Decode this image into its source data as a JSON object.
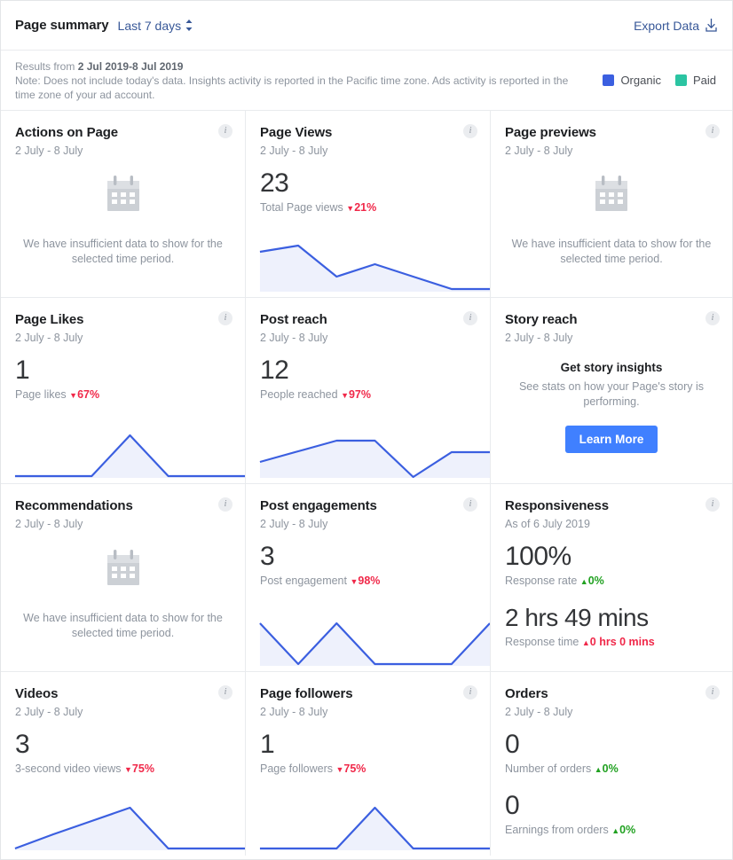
{
  "header": {
    "title": "Page summary",
    "range_label": "Last 7 days",
    "export_label": "Export Data",
    "export_icon": "download-icon",
    "range_icon": "sort-updown-icon"
  },
  "notes": {
    "results_prefix": "Results from ",
    "results_range": "2 Jul 2019-8 Jul 2019",
    "note_text": "Note: Does not include today's data. Insights activity is reported in the Pacific time zone. Ads activity is reported in the time zone of your ad account.",
    "legend": [
      {
        "label": "Organic",
        "color": "#3b5fe0"
      },
      {
        "label": "Paid",
        "color": "#2bc4a2"
      }
    ]
  },
  "colors": {
    "line": "#3b5fe0",
    "fill": "#eef1fc",
    "down": "#f02849",
    "up_green": "#21a121",
    "up_red": "#f02849",
    "accent_button": "#4080ff"
  },
  "cards": [
    {
      "id": "actions-on-page",
      "title": "Actions on Page",
      "subtitle": "2 July - 8 July",
      "state": "empty",
      "icon": "calendar-icon",
      "empty_text": "We have insufficient data to show for the selected time period."
    },
    {
      "id": "page-views",
      "title": "Page Views",
      "subtitle": "2 July - 8 July",
      "state": "metric",
      "value": "23",
      "label": "Total Page views",
      "delta": "21%",
      "delta_dir": "down"
    },
    {
      "id": "page-previews",
      "title": "Page previews",
      "subtitle": "2 July - 8 July",
      "state": "empty",
      "icon": "calendar-icon",
      "empty_text": "We have insufficient data to show for the selected time period."
    },
    {
      "id": "page-likes",
      "title": "Page Likes",
      "subtitle": "2 July - 8 July",
      "state": "metric",
      "value": "1",
      "label": "Page likes",
      "delta": "67%",
      "delta_dir": "down"
    },
    {
      "id": "post-reach",
      "title": "Post reach",
      "subtitle": "2 July - 8 July",
      "state": "metric",
      "value": "12",
      "label": "People reached",
      "delta": "97%",
      "delta_dir": "down"
    },
    {
      "id": "story-reach",
      "title": "Story reach",
      "subtitle": "2 July - 8 July",
      "state": "promo",
      "promo_title": "Get story insights",
      "promo_text": "See stats on how your Page's story is performing.",
      "promo_button": "Learn More"
    },
    {
      "id": "recommendations",
      "title": "Recommendations",
      "subtitle": "2 July - 8 July",
      "state": "empty",
      "icon": "calendar-icon",
      "empty_text": "We have insufficient data to show for the selected time period."
    },
    {
      "id": "post-engagements",
      "title": "Post engagements",
      "subtitle": "2 July - 8 July",
      "state": "metric",
      "value": "3",
      "label": "Post engagement",
      "delta": "98%",
      "delta_dir": "down"
    },
    {
      "id": "responsiveness",
      "title": "Responsiveness",
      "subtitle": "As of 6 July 2019",
      "state": "dual",
      "value": "100%",
      "label": "Response rate",
      "delta": "0%",
      "delta_dir": "up-green",
      "value2": "2 hrs 49 mins",
      "label2": "Response time",
      "delta2": "0 hrs 0 mins",
      "delta2_dir": "up-red"
    },
    {
      "id": "videos",
      "title": "Videos",
      "subtitle": "2 July - 8 July",
      "state": "metric",
      "value": "3",
      "label": "3-second video views",
      "delta": "75%",
      "delta_dir": "down"
    },
    {
      "id": "page-followers",
      "title": "Page followers",
      "subtitle": "2 July - 8 July",
      "state": "metric",
      "value": "1",
      "label": "Page followers",
      "delta": "75%",
      "delta_dir": "down"
    },
    {
      "id": "orders",
      "title": "Orders",
      "subtitle": "2 July - 8 July",
      "state": "dual",
      "value": "0",
      "label": "Number of orders",
      "delta": "0%",
      "delta_dir": "up-green",
      "value2": "0",
      "label2": "Earnings from orders",
      "delta2": "0%",
      "delta2_dir": "up-green"
    }
  ],
  "chart_data": [
    {
      "id": "page-views",
      "type": "area",
      "title": "Page Views",
      "x": [
        "2 Jul",
        "3 Jul",
        "4 Jul",
        "5 Jul",
        "6 Jul",
        "7 Jul",
        "8 Jul"
      ],
      "values": [
        6,
        7,
        2,
        4,
        2,
        0,
        0
      ],
      "series": [
        {
          "name": "Organic",
          "values": [
            6,
            7,
            2,
            4,
            2,
            0,
            0
          ]
        }
      ],
      "ylim": [
        0,
        7
      ],
      "grid": false,
      "legend": "none"
    },
    {
      "id": "page-likes",
      "type": "area",
      "title": "Page Likes",
      "x": [
        "2 Jul",
        "3 Jul",
        "4 Jul",
        "5 Jul",
        "6 Jul",
        "7 Jul",
        "8 Jul"
      ],
      "values": [
        0,
        0,
        0,
        1,
        0,
        0,
        0
      ],
      "series": [
        {
          "name": "Organic",
          "values": [
            0,
            0,
            0,
            1,
            0,
            0,
            0
          ]
        }
      ],
      "ylim": [
        0,
        1
      ],
      "grid": false,
      "legend": "none"
    },
    {
      "id": "post-reach",
      "type": "area",
      "title": "Post reach",
      "x": [
        "2 Jul",
        "3 Jul",
        "4 Jul",
        "5 Jul",
        "6 Jul",
        "7 Jul",
        "8 Jul"
      ],
      "values": [
        3,
        6,
        8,
        8,
        0,
        6,
        6
      ],
      "series": [
        {
          "name": "Organic",
          "values": [
            3,
            6,
            8,
            8,
            0,
            6,
            6
          ]
        }
      ],
      "ylim": [
        0,
        8
      ],
      "grid": false,
      "legend": "none"
    },
    {
      "id": "post-engagements",
      "type": "area",
      "title": "Post engagements",
      "x": [
        "2 Jul",
        "3 Jul",
        "4 Jul",
        "5 Jul",
        "6 Jul",
        "7 Jul",
        "8 Jul"
      ],
      "values": [
        1,
        0,
        1,
        0,
        0,
        0,
        1
      ],
      "series": [
        {
          "name": "Organic",
          "values": [
            1,
            0,
            1,
            0,
            0,
            0,
            1
          ]
        }
      ],
      "ylim": [
        0,
        1
      ],
      "grid": false,
      "legend": "none"
    },
    {
      "id": "videos",
      "type": "area",
      "title": "Videos",
      "x": [
        "2 Jul",
        "3 Jul",
        "4 Jul",
        "5 Jul",
        "6 Jul",
        "7 Jul",
        "8 Jul"
      ],
      "values": [
        0,
        1,
        2,
        3,
        0,
        0,
        0
      ],
      "series": [
        {
          "name": "Organic",
          "values": [
            0,
            1,
            2,
            3,
            0,
            0,
            0
          ]
        }
      ],
      "ylim": [
        0,
        3
      ],
      "grid": false,
      "legend": "none"
    },
    {
      "id": "page-followers",
      "type": "area",
      "title": "Page followers",
      "x": [
        "2 Jul",
        "3 Jul",
        "4 Jul",
        "5 Jul",
        "6 Jul",
        "7 Jul",
        "8 Jul"
      ],
      "values": [
        0,
        0,
        0,
        1,
        0,
        0,
        0
      ],
      "series": [
        {
          "name": "Organic",
          "values": [
            0,
            0,
            0,
            1,
            0,
            0,
            0
          ]
        }
      ],
      "ylim": [
        0,
        1
      ],
      "grid": false,
      "legend": "none"
    }
  ]
}
